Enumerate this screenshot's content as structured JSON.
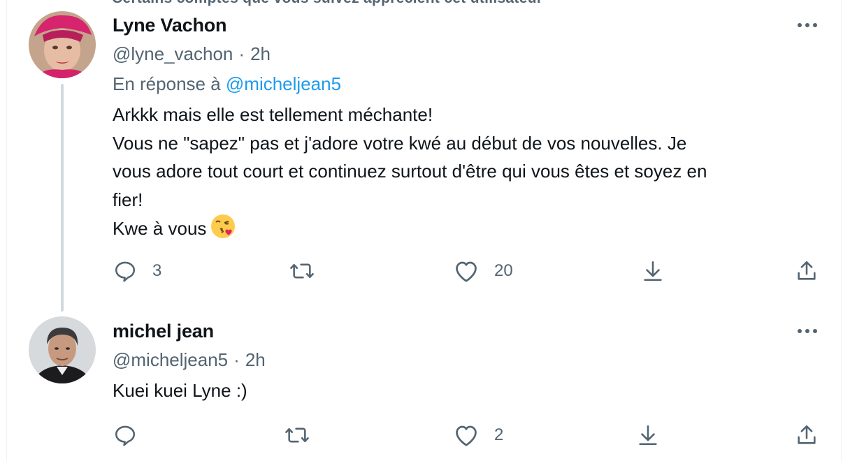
{
  "top_notice": "Certains comptes que vous suivez apprécient cet utilisateur",
  "tweets": [
    {
      "name": "Lyne Vachon",
      "handle": "@lyne_vachon",
      "separator": "·",
      "time": "2h",
      "reply_prefix": "En réponse à ",
      "reply_mention": "@micheljean5",
      "lines": [
        "Arkkk mais elle est tellement méchante!",
        "Vous ne \"sapez\" pas et j'adore votre kwé au début de vos nouvelles. Je",
        "vous adore tout court et continuez surtout d'être qui vous êtes et soyez en",
        "fier!",
        "Kwe à vous"
      ],
      "emoji": "face-blowing-a-kiss-icon",
      "reply_count": "3",
      "retweet_count": "",
      "like_count": "20"
    },
    {
      "name": "michel jean",
      "handle": "@micheljean5",
      "separator": "·",
      "time": "2h",
      "lines": [
        "Kuei kuei Lyne :)"
      ],
      "reply_count": "",
      "retweet_count": "",
      "like_count": "2"
    }
  ],
  "colors": {
    "text": "#0f1419",
    "secondary": "#536471",
    "link": "#1d9bf0",
    "thread_line": "#cfd9de"
  },
  "icons": [
    "retweet-icon",
    "reply-icon",
    "like-icon",
    "bookmark-icon",
    "share-icon",
    "more-icon"
  ]
}
